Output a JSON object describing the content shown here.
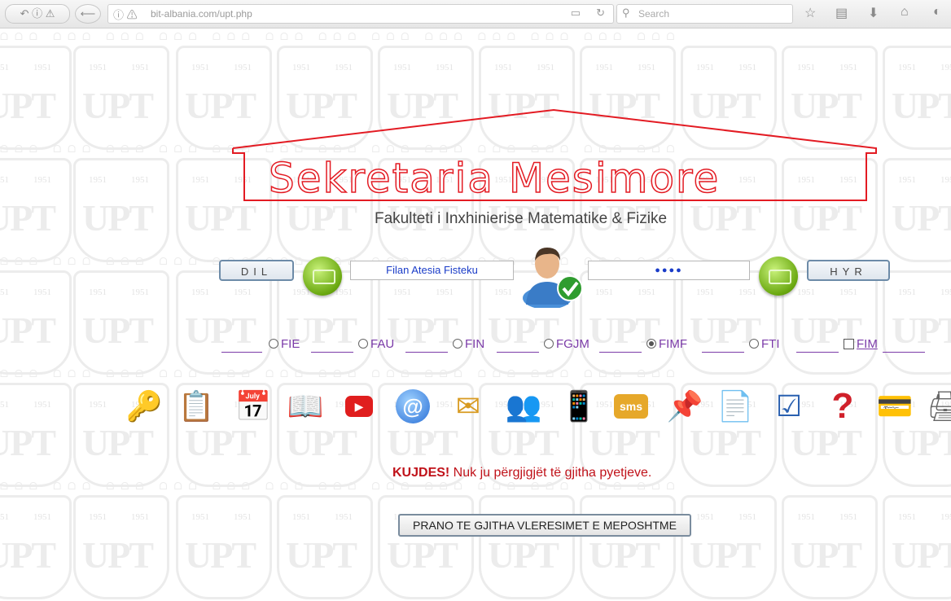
{
  "browser": {
    "url": "bit-albania.com/upt.php",
    "search_placeholder": "Search"
  },
  "header": {
    "title": "Sekretaria Mesimore",
    "subtitle": "Fakulteti i Inxhinierise Matematike & Fizike"
  },
  "login": {
    "exit_label": "DIL",
    "username_value": "Filan Atesia Fisteku",
    "password_value": "●●●●",
    "enter_label": "HYR"
  },
  "faculties": [
    {
      "label": "FIE",
      "type": "radio",
      "selected": false
    },
    {
      "label": "FAU",
      "type": "radio",
      "selected": false
    },
    {
      "label": "FIN",
      "type": "radio",
      "selected": false
    },
    {
      "label": "FGJM",
      "type": "radio",
      "selected": false
    },
    {
      "label": "FIMF",
      "type": "radio",
      "selected": true
    },
    {
      "label": "FTI",
      "type": "radio",
      "selected": false
    },
    {
      "label": "FIM",
      "type": "checkbox",
      "selected": false
    }
  ],
  "toolbar_icons": [
    "keys-icon",
    "clipboard-icon",
    "calendar-clock-icon",
    "book-icon",
    "youtube-icon",
    "email-at-icon",
    "mail-arrow-icon",
    "group-icon",
    "mobile-phone-icon",
    "sms-icon",
    "pushpin-icon",
    "user-document-icon",
    "checked-document-icon",
    "help-question-icon",
    "credit-card-icon",
    "printer-icon"
  ],
  "warning": {
    "strong": "KUJDES!",
    "text": " Nuk ju përgjigjët të gjitha pyetjeve."
  },
  "accept_button": "PRANO TE GJITHA VLERESIMET E MEPOSHTME",
  "watermark": {
    "logo": "UPT",
    "year": "1951"
  },
  "colors": {
    "title_red": "#e31b23",
    "faculty_purple": "#7b3ba8",
    "warning_red": "#c0121a"
  }
}
